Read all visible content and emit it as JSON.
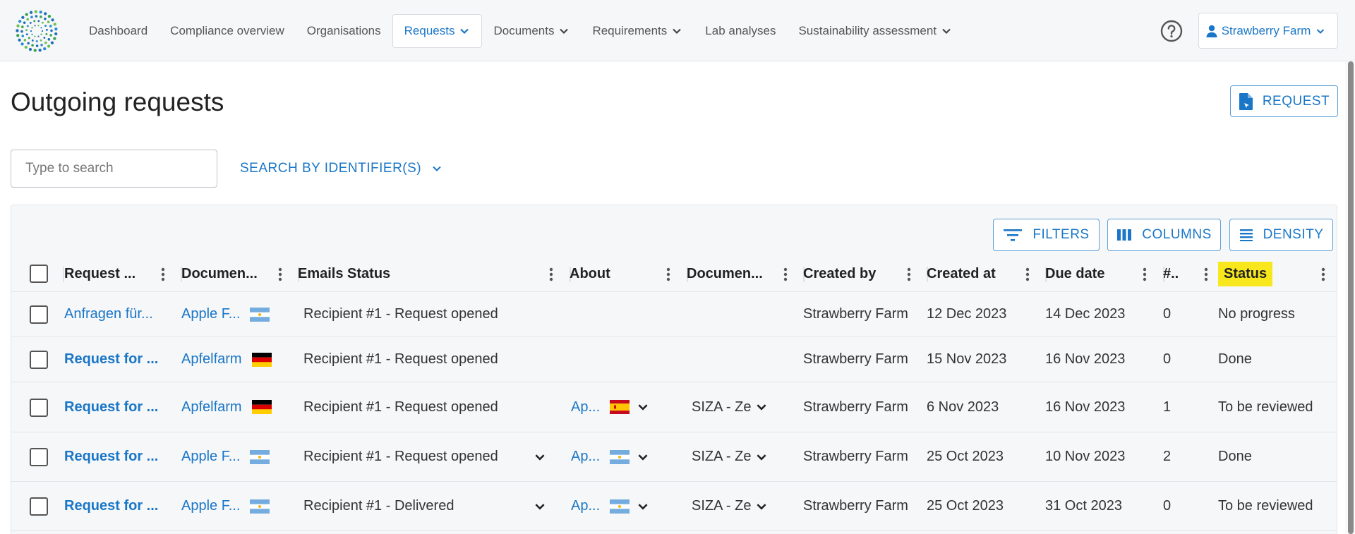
{
  "nav": {
    "items": [
      {
        "label": "Dashboard",
        "dropdown": false,
        "active": false
      },
      {
        "label": "Compliance overview",
        "dropdown": false,
        "active": false
      },
      {
        "label": "Organisations",
        "dropdown": false,
        "active": false
      },
      {
        "label": "Requests",
        "dropdown": true,
        "active": true
      },
      {
        "label": "Documents",
        "dropdown": true,
        "active": false
      },
      {
        "label": "Requirements",
        "dropdown": true,
        "active": false
      },
      {
        "label": "Lab analyses",
        "dropdown": false,
        "active": false
      },
      {
        "label": "Sustainability assessment",
        "dropdown": true,
        "active": false
      }
    ],
    "account_label": "Strawberry Farm",
    "accent_color": "#1a76c7"
  },
  "page": {
    "title": "Outgoing requests",
    "request_button": "REQUEST",
    "search_placeholder": "Type to search",
    "search_by_identifier": "SEARCH BY IDENTIFIER(S)"
  },
  "toolbar": {
    "filters": "FILTERS",
    "columns": "COLUMNS",
    "density": "DENSITY"
  },
  "table": {
    "headers": [
      "Request ...",
      "Documen...",
      "Emails Status",
      "About",
      "Documen...",
      "Created by",
      "Created at",
      "Due date",
      "#..",
      "Status"
    ],
    "rows": [
      {
        "request": "Anfragen für...",
        "request_bold": false,
        "document": "Apple F...",
        "document_flag": "argentina",
        "emails": "Recipient #1 - Request opened",
        "emails_dd": false,
        "about": "",
        "about_flag": "",
        "doc2": "",
        "created_by": "Strawberry Farm",
        "created_at": "12 Dec 2023",
        "due_date": "14 Dec 2023",
        "count": "0",
        "status": "No progress"
      },
      {
        "request": "Request for ...",
        "request_bold": true,
        "document": "Apfelfarm",
        "document_flag": "germany",
        "emails": "Recipient #1 - Request opened",
        "emails_dd": false,
        "about": "",
        "about_flag": "",
        "doc2": "",
        "created_by": "Strawberry Farm",
        "created_at": "15 Nov 2023",
        "due_date": "16 Nov 2023",
        "count": "0",
        "status": "Done"
      },
      {
        "request": "Request for ...",
        "request_bold": true,
        "document": "Apfelfarm",
        "document_flag": "germany",
        "emails": "Recipient #1 - Request opened",
        "emails_dd": false,
        "about": "Ap...",
        "about_flag": "spain",
        "doc2": "SIZA - Ze",
        "created_by": "Strawberry Farm",
        "created_at": "6 Nov 2023",
        "due_date": "16 Nov 2023",
        "count": "1",
        "status": "To be reviewed"
      },
      {
        "request": "Request for ...",
        "request_bold": true,
        "document": "Apple F...",
        "document_flag": "argentina",
        "emails": "Recipient #1 - Request opened",
        "emails_dd": true,
        "about": "Ap...",
        "about_flag": "argentina",
        "doc2": "SIZA - Ze",
        "created_by": "Strawberry Farm",
        "created_at": "25 Oct 2023",
        "due_date": "10 Nov 2023",
        "count": "2",
        "status": "Done"
      },
      {
        "request": "Request for ...",
        "request_bold": true,
        "document": "Apple F...",
        "document_flag": "argentina",
        "emails": "Recipient #1 - Delivered",
        "emails_dd": true,
        "about": "Ap...",
        "about_flag": "argentina",
        "doc2": "SIZA - Ze",
        "created_by": "Strawberry Farm",
        "created_at": "25 Oct 2023",
        "due_date": "31 Oct 2023",
        "count": "0",
        "status": "To be reviewed"
      }
    ]
  }
}
